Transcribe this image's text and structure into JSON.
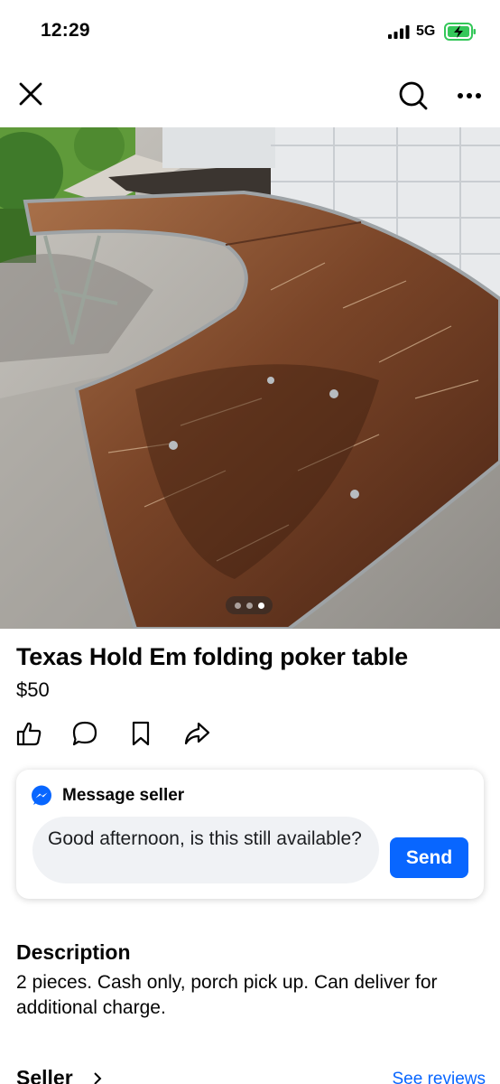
{
  "status_bar": {
    "time": "12:29",
    "network": "5G",
    "icons": [
      "signal-bars-icon",
      "battery-charging-icon"
    ]
  },
  "nav": {
    "icons": [
      "close-icon",
      "search-icon",
      "more-icon"
    ]
  },
  "listing": {
    "title": "Texas Hold Em folding poker table",
    "price": "$50",
    "photo_count": 3,
    "active_photo_index": 3
  },
  "actions": {
    "icons": [
      "like-icon",
      "comment-icon",
      "save-icon",
      "share-icon"
    ]
  },
  "message": {
    "header": "Message seller",
    "input_value": "Good afternoon, is this still available?",
    "send_label": "Send",
    "icon": "messenger-icon"
  },
  "description": {
    "heading": "Description",
    "text": "2 pieces.  Cash only, porch pick up.  Can deliver for additional charge."
  },
  "seller": {
    "label": "Seller",
    "reviews_link": "See reviews"
  },
  "colors": {
    "accent": "#0866ff",
    "input_bg": "#f0f2f5",
    "text": "#050505"
  }
}
